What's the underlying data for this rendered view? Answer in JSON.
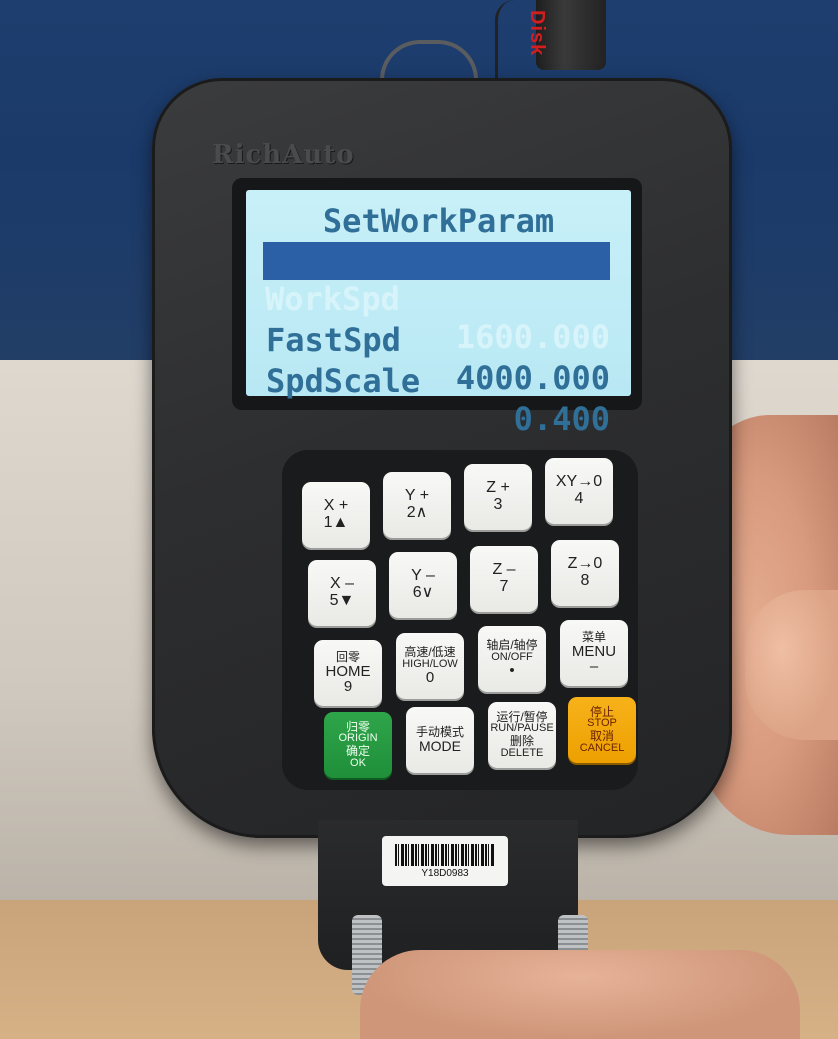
{
  "device": {
    "brand": "RichAuto",
    "usb_label": "Disk",
    "barcode_text": "Y18D0983"
  },
  "lcd": {
    "title": "SetWorkParam",
    "rows": [
      {
        "label": "WorkSpd",
        "value": "1600.000",
        "selected": true
      },
      {
        "label": "FastSpd",
        "value": "4000.000",
        "selected": false
      },
      {
        "label": "SpdScale",
        "value": "0.400",
        "selected": false
      }
    ]
  },
  "keys": [
    {
      "l1": "X +",
      "l2": "1▲"
    },
    {
      "l1": "Y +",
      "l2": "2∧"
    },
    {
      "l1": "Z +",
      "l2": "3"
    },
    {
      "l1": "XY→0",
      "l2": "4"
    },
    {
      "l1": "X –",
      "l2": "5▼"
    },
    {
      "l1": "Y –",
      "l2": "6∨"
    },
    {
      "l1": "Z –",
      "l2": "7"
    },
    {
      "l1": "Z→0",
      "l2": "8"
    },
    {
      "l1": "回零",
      "l2": "HOME",
      "l3": "9"
    },
    {
      "l1": "高速/低速",
      "l2": "HIGH/LOW",
      "l3": "0"
    },
    {
      "l1": "轴启/轴停",
      "l2": "ON/OFF",
      "l3": "•"
    },
    {
      "l1": "菜单",
      "l2": "MENU",
      "l3": "–"
    },
    {
      "l1": "归零",
      "l2": "ORIGIN",
      "l3": "确定",
      "l4": "OK"
    },
    {
      "l1": "手动模式",
      "l2": "MODE"
    },
    {
      "l1": "运行/暂停",
      "l2": "RUN/PAUSE",
      "l3": "删除",
      "l4": "DELETE"
    },
    {
      "l1": "停止",
      "l2": "STOP",
      "l3": "取消",
      "l4": "CANCEL"
    }
  ],
  "colors": {
    "lcd_bg": "#c8f0f8",
    "lcd_text": "#2f6f98",
    "lcd_highlight": "#2b5fa6",
    "origin_key": "#2fa54a",
    "cancel_key": "#f7b21a",
    "pendant_body": "#2d2e30"
  }
}
